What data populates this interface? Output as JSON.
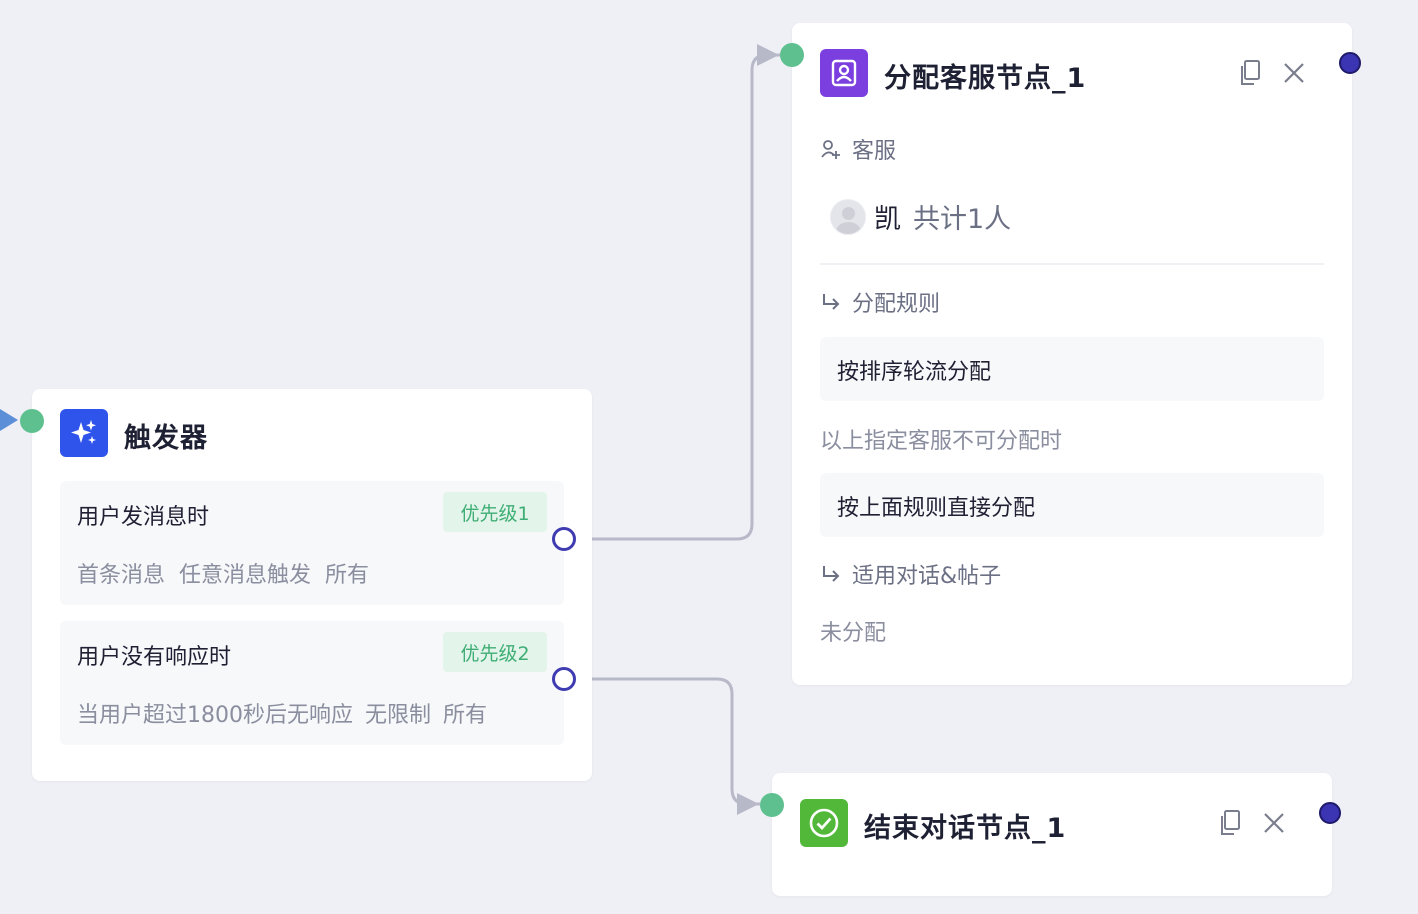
{
  "trigger_node": {
    "title": "触发器",
    "icon": "sparkle-icon",
    "icon_color": "#2f54eb",
    "rows": [
      {
        "label": "用户发消息时",
        "badge": "优先级1",
        "desc": [
          "首条消息",
          "任意消息触发",
          "所有"
        ]
      },
      {
        "label": "用户没有响应时",
        "badge": "优先级2",
        "desc": [
          "当用户超过1800秒后无响应",
          "无限制",
          "所有"
        ]
      }
    ]
  },
  "assign_node": {
    "title": "分配客服节点_1",
    "icon": "agent-badge-icon",
    "icon_color": "#7b3fe0",
    "agent_section_label": "客服",
    "agent_name": "凯",
    "agent_count": "共计1人",
    "rule_section_label": "分配规则",
    "rule_value": "按排序轮流分配",
    "fallback_label": "以上指定客服不可分配时",
    "fallback_value": "按上面规则直接分配",
    "scope_section_label": "适用对话&帖子",
    "scope_value": "未分配"
  },
  "end_node": {
    "title": "结束对话节点_1",
    "icon": "check-circle-icon",
    "icon_color": "#52b83a"
  },
  "colors": {
    "port_in": "#5ec08f",
    "port_out": "#3f3bb0",
    "badge_bg": "#e3f4ea",
    "badge_text": "#3fae75",
    "wire": "#b7b9c9"
  }
}
